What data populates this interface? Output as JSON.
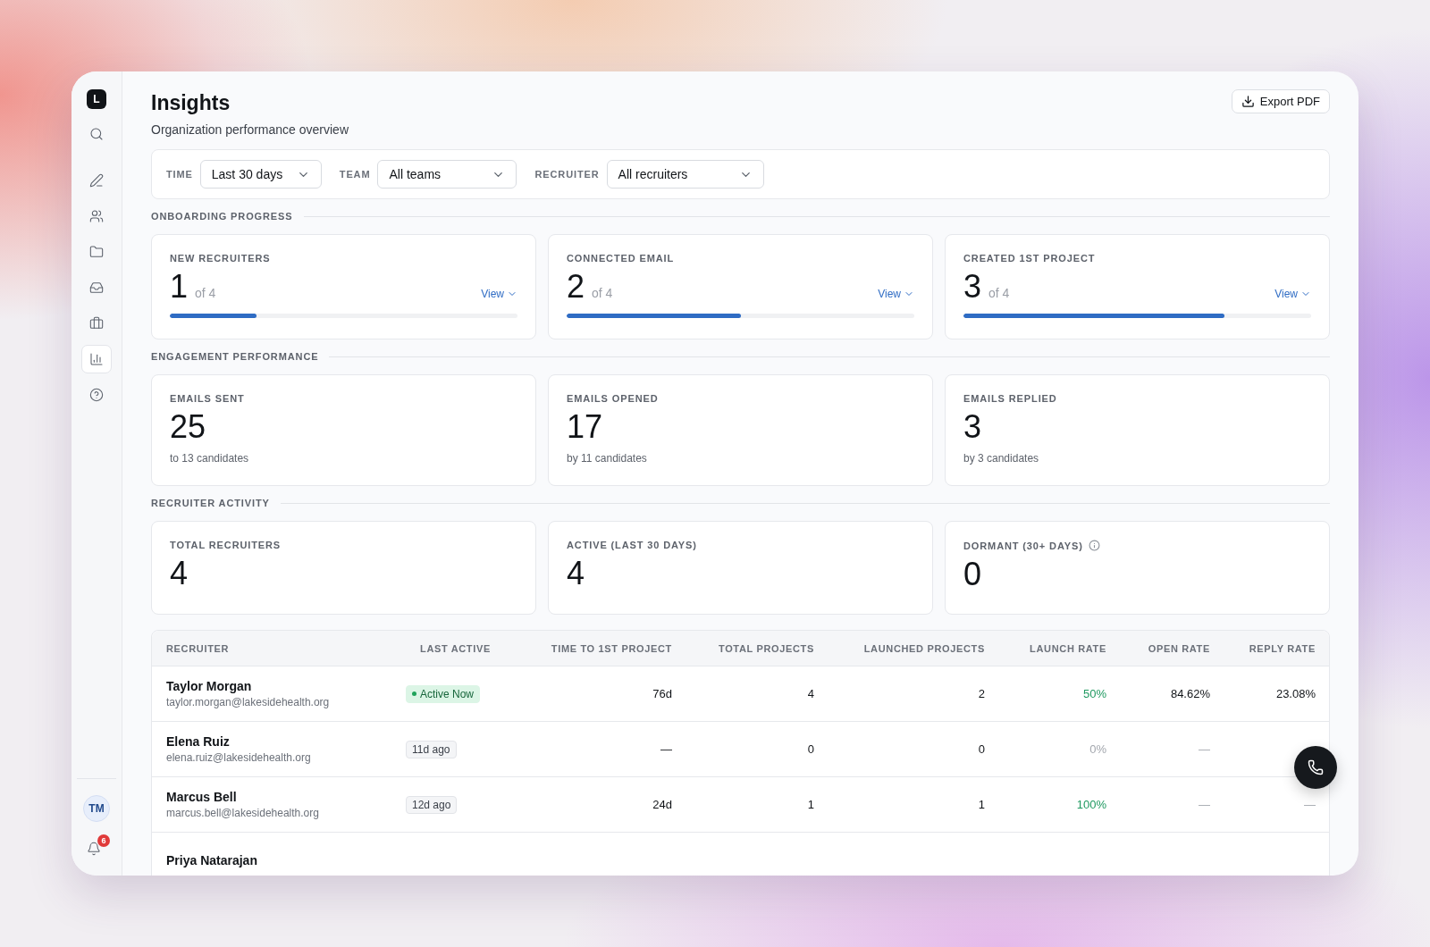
{
  "sidebar": {
    "logo": "L",
    "items": [
      {
        "selected": false
      },
      {
        "selected": false
      },
      {
        "selected": false
      },
      {
        "selected": false
      },
      {
        "selected": false
      },
      {
        "selected": false
      },
      {
        "selected": true
      },
      {
        "selected": false
      }
    ],
    "avatar": "TM",
    "notifications": "6"
  },
  "header": {
    "title": "Insights",
    "subtitle": "Organization performance overview",
    "export_button": "Export PDF"
  },
  "filters": [
    {
      "label": "TIME",
      "value": "Last 30 days"
    },
    {
      "label": "TEAM",
      "value": "All teams"
    },
    {
      "label": "RECRUITER",
      "value": "All recruiters"
    }
  ],
  "onboarding": {
    "title": "ONBOARDING PROGRESS",
    "cards": [
      {
        "label": "NEW RECRUITERS",
        "value": "1",
        "total": "of 4",
        "link": "View",
        "level": 0.25
      },
      {
        "label": "CONNECTED EMAIL",
        "value": "2",
        "total": "of 4",
        "link": "View",
        "level": 0.5
      },
      {
        "label": "CREATED 1ST PROJECT",
        "value": "3",
        "total": "of 4",
        "link": "View",
        "level": 0.75
      }
    ]
  },
  "engagement": {
    "title": "ENGAGEMENT PERFORMANCE",
    "cards": [
      {
        "label": "EMAILS SENT",
        "value": "25",
        "note": "to 13 candidates"
      },
      {
        "label": "EMAILS OPENED",
        "value": "17",
        "note": "by 11 candidates"
      },
      {
        "label": "EMAILS REPLIED",
        "value": "3",
        "note": "by 3 candidates"
      }
    ]
  },
  "activity": {
    "title": "RECRUITER ACTIVITY",
    "cards": [
      {
        "label": "TOTAL RECRUITERS",
        "value": "4",
        "info": false
      },
      {
        "label": "ACTIVE (LAST 30 DAYS)",
        "value": "4",
        "info": false
      },
      {
        "label": "DORMANT (30+ DAYS)",
        "value": "0",
        "info": true
      }
    ]
  },
  "table": {
    "columns": [
      "RECRUITER",
      "LAST ACTIVE",
      "TIME TO 1ST PROJECT",
      "TOTAL PROJECTS",
      "LAUNCHED PROJECTS",
      "LAUNCH RATE",
      "OPEN RATE",
      "REPLY RATE"
    ],
    "rows": [
      {
        "name": "Taylor Morgan",
        "email": "taylor.morgan@lakesidehealth.org",
        "last_active": {
          "text": "Active Now",
          "kind": "active"
        },
        "cells": [
          {
            "text": "76d",
            "kind": "plain"
          },
          {
            "text": "4",
            "kind": "plain"
          },
          {
            "text": "2",
            "kind": "plain"
          },
          {
            "text": "50%",
            "kind": "positive"
          },
          {
            "text": "84.62%",
            "kind": "plain"
          },
          {
            "text": "23.08%",
            "kind": "plain"
          }
        ]
      },
      {
        "name": "Elena Ruiz",
        "email": "elena.ruiz@lakesidehealth.org",
        "last_active": {
          "text": "11d ago",
          "kind": "ago"
        },
        "cells": [
          {
            "text": "—",
            "kind": "plain"
          },
          {
            "text": "0",
            "kind": "plain"
          },
          {
            "text": "0",
            "kind": "plain"
          },
          {
            "text": "0%",
            "kind": "muted"
          },
          {
            "text": "—",
            "kind": "muted"
          }
        ]
      },
      {
        "name": "Marcus Bell",
        "email": "marcus.bell@lakesidehealth.org",
        "last_active": {
          "text": "12d ago",
          "kind": "ago"
        },
        "cells": [
          {
            "text": "24d",
            "kind": "plain"
          },
          {
            "text": "1",
            "kind": "plain"
          },
          {
            "text": "1",
            "kind": "plain"
          },
          {
            "text": "100%",
            "kind": "positive"
          },
          {
            "text": "—",
            "kind": "muted"
          },
          {
            "text": "—",
            "kind": "muted"
          }
        ]
      },
      {
        "name": "Priya Natarajan"
      }
    ]
  }
}
